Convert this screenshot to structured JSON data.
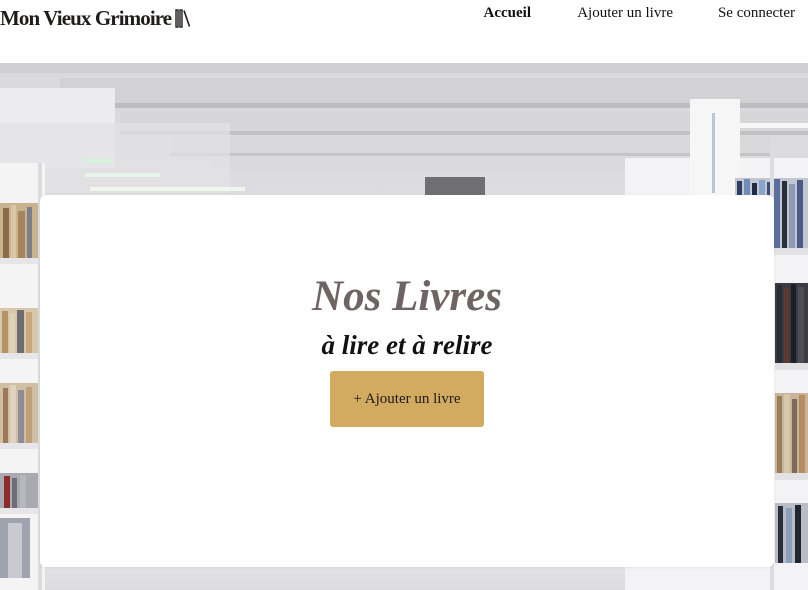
{
  "header": {
    "logo_text": "Mon Vieux Grimoire",
    "nav": [
      {
        "label": "Accueil",
        "active": true
      },
      {
        "label": "Ajouter un livre",
        "active": false
      },
      {
        "label": "Se connecter",
        "active": false
      }
    ]
  },
  "hero": {
    "title": "Nos Livres",
    "subtitle": "à lire et à relire",
    "add_button_label": "+ Ajouter un livre"
  },
  "colors": {
    "accent_button": "#d2aa60",
    "title_text": "#6e6463",
    "header_bg": "#ffffff",
    "card_bg": "#ffffff"
  },
  "icons": {
    "logo": "books-icon"
  }
}
